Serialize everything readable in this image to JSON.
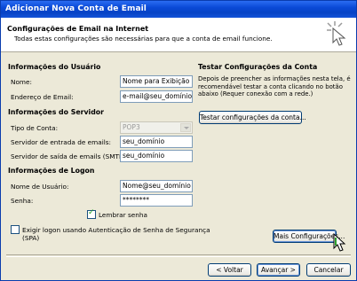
{
  "window": {
    "title": "Adicionar Nova Conta de Email"
  },
  "header": {
    "title": "Configurações de Email na Internet",
    "subtitle": "Todas estas configurações são necessárias para que a conta de email funcione."
  },
  "user_info": {
    "heading": "Informações do Usuário",
    "name_label": "Nome:",
    "name_value": "Nome para Exibição",
    "email_label": "Endereço de Email:",
    "email_value": "e-mail@seu_domínio"
  },
  "server_info": {
    "heading": "Informações do Servidor",
    "account_type_label": "Tipo de Conta:",
    "account_type_value": "POP3",
    "incoming_label": "Servidor de entrada de emails:",
    "incoming_value": "seu_domínio",
    "outgoing_label": "Servidor de saída de emails (SMTP):",
    "outgoing_value": "seu_domínio"
  },
  "logon_info": {
    "heading": "Informações de Logon",
    "username_label": "Nome de Usuário:",
    "username_value": "Nome@seu_domínio",
    "password_label": "Senha:",
    "password_value": "********",
    "remember_label": "Lembrar senha",
    "remember_checked": true,
    "spa_label_line1": "Exigir logon usando Autenticação de Senha de Segurança",
    "spa_label_line2": "(SPA)",
    "spa_checked": false
  },
  "test_section": {
    "heading": "Testar Configurações da Conta",
    "description": "Depois de preencher as informações nesta tela, é recomendável testar a conta clicando no botão abaixo (Requer conexão com a rede.)",
    "test_button": "Testar configurações da conta...",
    "more_settings_button": "Mais Configurações..."
  },
  "footer": {
    "back_button": "< Voltar",
    "next_button": "Avançar >",
    "cancel_button": "Cancelar"
  }
}
